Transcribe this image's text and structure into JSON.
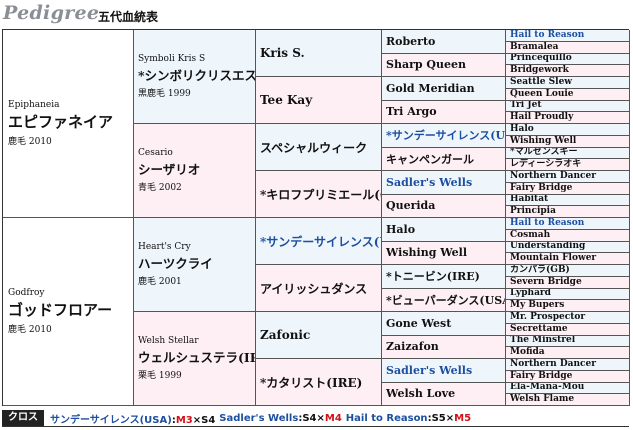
{
  "header": {
    "title_en": "Pedigree",
    "title_jp": "五代血統表"
  },
  "sire": {
    "name_en": "Epiphaneia",
    "name_jp": "エピファネイア",
    "info": "鹿毛 2010",
    "sire": {
      "name_en": "Symboli Kris S",
      "name_jp": "*シンボリクリスエス(USA)",
      "info": "黒鹿毛 1999",
      "sire": {
        "name": "Kris S.",
        "sire": {
          "name": "Roberto",
          "sire": "Hail to Reason",
          "dam": "Bramalea"
        },
        "dam": {
          "name": "Sharp Queen",
          "sire": "Princequillo",
          "dam": "Bridgework"
        }
      },
      "dam": {
        "name": "Tee Kay",
        "sire": {
          "name": "Gold Meridian",
          "sire": "Seattle Slew",
          "dam": "Queen Louie"
        },
        "dam": {
          "name": "Tri Argo",
          "sire": "Tri Jet",
          "dam": "Hail Proudly"
        }
      }
    },
    "dam": {
      "name_en": "Cesario",
      "name_jp": "シーザリオ",
      "info": "青毛 2002",
      "sire": {
        "name": "スペシャルウィーク",
        "sire": {
          "name": "*サンデーサイレンス(USA)",
          "sire": "Halo",
          "dam": "Wishing Well"
        },
        "dam": {
          "name": "キャンペンガール",
          "sire": "*マルゼンスキー",
          "dam": "レディーシラオキ"
        }
      },
      "dam": {
        "name": "*キロフプリミエール(GB)",
        "sire": {
          "name": "Sadler's Wells",
          "sire": "Northern Dancer",
          "dam": "Fairy Bridge"
        },
        "dam": {
          "name": "Querida",
          "sire": "Habitat",
          "dam": "Principia"
        }
      }
    }
  },
  "dam": {
    "name_en": "Godfroy",
    "name_jp": "ゴッドフロアー",
    "info": "鹿毛 2010",
    "sire": {
      "name_en": "Heart's Cry",
      "name_jp": "ハーツクライ",
      "info": "鹿毛 2001",
      "sire": {
        "name": "*サンデーサイレンス(USA)",
        "sire": {
          "name": "Halo",
          "sire": "Hail to Reason",
          "dam": "Cosmah"
        },
        "dam": {
          "name": "Wishing Well",
          "sire": "Understanding",
          "dam": "Mountain Flower"
        }
      },
      "dam": {
        "name": "アイリッシュダンス",
        "sire": {
          "name": "*トニービン(IRE)",
          "sire": "カンパラ(GB)",
          "dam": "Severn Bridge"
        },
        "dam": {
          "name": "*ビューパーダンス(USA)",
          "sire": "Lyphard",
          "dam": "My Bupers"
        }
      }
    },
    "dam": {
      "name_en": "Welsh Stellar",
      "name_jp": "ウェルシュステラ(IRE)",
      "info": "栗毛 1999",
      "sire": {
        "name": "Zafonic",
        "sire": {
          "name": "Gone West",
          "sire": "Mr. Prospector",
          "dam": "Secrettame"
        },
        "dam": {
          "name": "Zaizafon",
          "sire": "The Minstrel",
          "dam": "Mofida"
        }
      },
      "dam": {
        "name": "*カタリスト(IRE)",
        "sire": {
          "name": "Sadler's Wells",
          "sire": "Northern Dancer",
          "dam": "Fairy Bridge"
        },
        "dam": {
          "name": "Welsh Love",
          "sire": "Ela-Mana-Mou",
          "dam": "Welsh Flame"
        }
      }
    }
  },
  "cross": {
    "label": "クロス",
    "items": [
      {
        "horse": "サンデーサイレンス(USA)",
        "sep": ":",
        "male": "M3",
        "x1": "×",
        "female": "S4",
        "end": ""
      },
      {
        "horse": "Sadler's Wells",
        "sep": ":",
        "male": "S4",
        "x1": "×",
        "female": "M4",
        "end": ""
      },
      {
        "horse": "Hail to Reason",
        "sep": ":",
        "male": "S5",
        "x1": "×",
        "female": "M5",
        "end": ""
      }
    ]
  },
  "highlight": [
    "Hail to Reason",
    "*サンデーサイレンス(USA)",
    "Sadler's Wells"
  ],
  "colors": {
    "sire_bg": "#eef6fc",
    "dam_bg": "#fdeff3",
    "highlight": "#1c4fa0",
    "female_cross": "#d0121b"
  }
}
